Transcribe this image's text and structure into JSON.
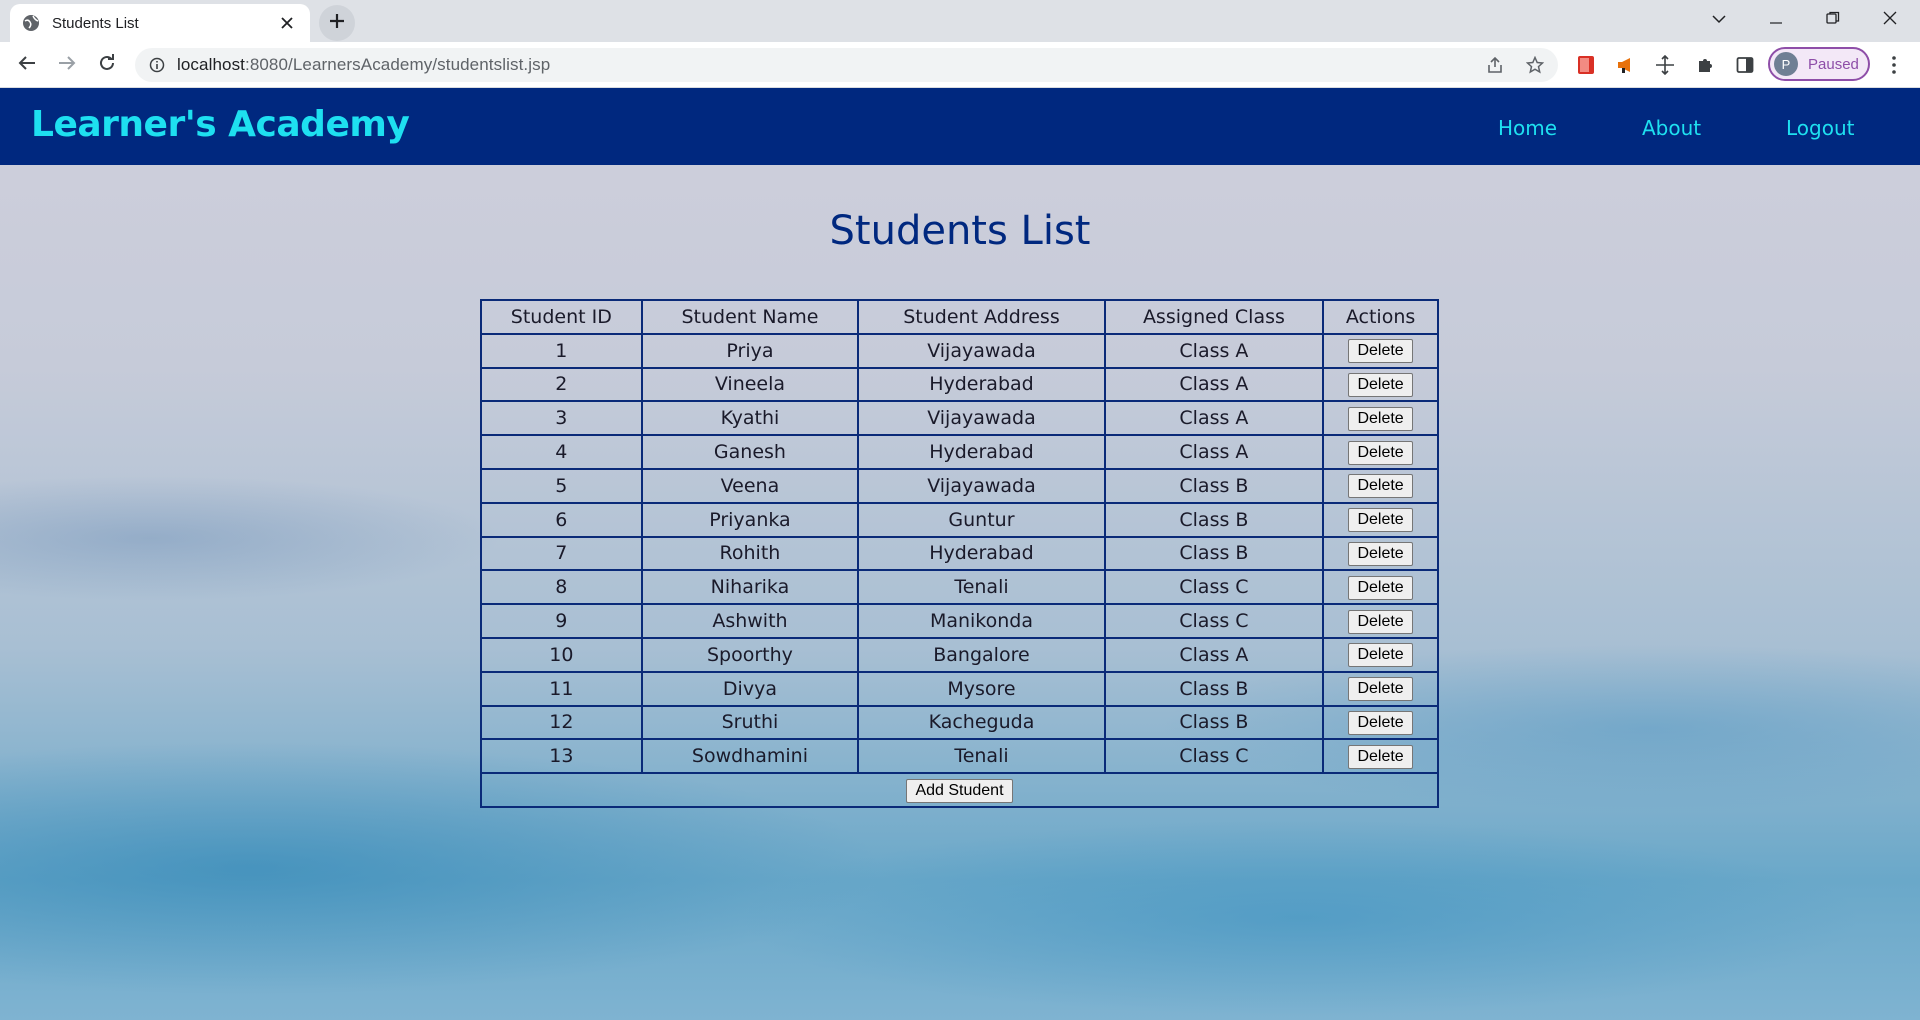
{
  "browser": {
    "tab_title": "Students List",
    "url_host": "localhost",
    "url_path": ":8080/LearnersAcademy/studentslist.jsp",
    "profile_initial": "P",
    "profile_label": "Paused"
  },
  "navbar": {
    "brand": "Learner's Academy",
    "links": {
      "home": "Home",
      "about": "About",
      "logout": "Logout"
    }
  },
  "main": {
    "heading": "Students List",
    "columns": [
      "Student ID",
      "Student Name",
      "Student Address",
      "Assigned Class",
      "Actions"
    ],
    "rows": [
      {
        "id": "1",
        "name": "Priya",
        "address": "Vijayawada",
        "cls": "Class A",
        "action": "Delete"
      },
      {
        "id": "2",
        "name": "Vineela",
        "address": "Hyderabad",
        "cls": "Class A",
        "action": "Delete"
      },
      {
        "id": "3",
        "name": "Kyathi",
        "address": "Vijayawada",
        "cls": "Class A",
        "action": "Delete"
      },
      {
        "id": "4",
        "name": "Ganesh",
        "address": "Hyderabad",
        "cls": "Class A",
        "action": "Delete"
      },
      {
        "id": "5",
        "name": "Veena",
        "address": "Vijayawada",
        "cls": "Class B",
        "action": "Delete"
      },
      {
        "id": "6",
        "name": "Priyanka",
        "address": "Guntur",
        "cls": "Class B",
        "action": "Delete"
      },
      {
        "id": "7",
        "name": "Rohith",
        "address": "Hyderabad",
        "cls": "Class B",
        "action": "Delete"
      },
      {
        "id": "8",
        "name": "Niharika",
        "address": "Tenali",
        "cls": "Class C",
        "action": "Delete"
      },
      {
        "id": "9",
        "name": "Ashwith",
        "address": "Manikonda",
        "cls": "Class C",
        "action": "Delete"
      },
      {
        "id": "10",
        "name": "Spoorthy",
        "address": "Bangalore",
        "cls": "Class A",
        "action": "Delete"
      },
      {
        "id": "11",
        "name": "Divya",
        "address": "Mysore",
        "cls": "Class B",
        "action": "Delete"
      },
      {
        "id": "12",
        "name": "Sruthi",
        "address": "Kacheguda",
        "cls": "Class B",
        "action": "Delete"
      },
      {
        "id": "13",
        "name": "Sowdhamini",
        "address": "Tenali",
        "cls": "Class C",
        "action": "Delete"
      }
    ],
    "add_button": "Add Student"
  },
  "colors": {
    "navbar_bg": "#00287f",
    "brand": "#1ee0f0",
    "heading": "#00287f",
    "profile_accent": "#8e4ea8"
  },
  "icons": [
    "globe-icon",
    "close-icon",
    "plus-icon",
    "chevron-down-icon",
    "minimize-icon",
    "restore-icon",
    "window-close-icon",
    "back-arrow-icon",
    "forward-arrow-icon",
    "reload-icon",
    "info-icon",
    "share-icon",
    "star-icon",
    "extension-book-icon",
    "extension-megaphone-icon",
    "extension-move-icon",
    "puzzle-icon",
    "side-panel-icon",
    "kebab-menu-icon"
  ]
}
